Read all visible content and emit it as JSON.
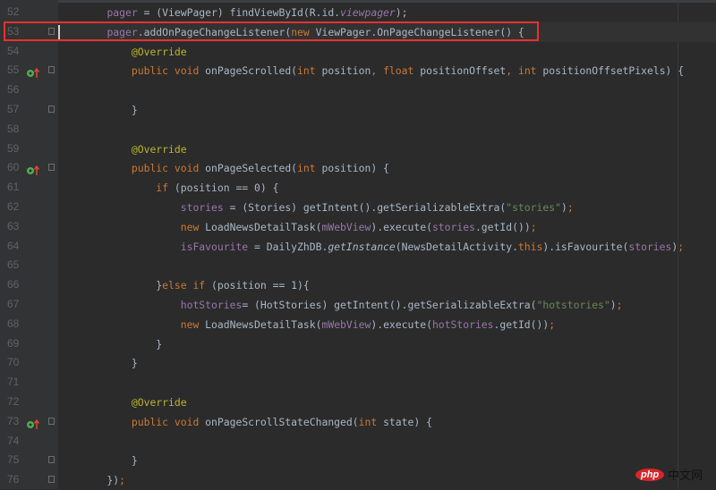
{
  "editor": {
    "current_line": 53,
    "highlighted_line": 53,
    "override_lines": [
      55,
      60,
      73
    ],
    "fold_lines": [
      53,
      55,
      57,
      60,
      73,
      75,
      76
    ],
    "lines": [
      {
        "num": "52",
        "tokens": [
          [
            "    ",
            ""
          ],
          [
            "pager",
            "f"
          ],
          [
            " = (ViewPager) findViewById(R.id.",
            ""
          ],
          [
            "viewpager",
            "fi"
          ],
          [
            ");",
            ""
          ]
        ]
      },
      {
        "num": "53",
        "tokens": [
          [
            "    ",
            ""
          ],
          [
            "pager",
            "f"
          ],
          [
            ".addOnPageChangeListener(",
            ""
          ],
          [
            "new ",
            "k"
          ],
          [
            "ViewPager.OnPageChangeListener() {",
            ""
          ]
        ]
      },
      {
        "num": "54",
        "tokens": [
          [
            "        ",
            ""
          ],
          [
            "@Override",
            "a"
          ]
        ]
      },
      {
        "num": "55",
        "tokens": [
          [
            "        ",
            ""
          ],
          [
            "public void ",
            "k"
          ],
          [
            "onPageScrolled(",
            ""
          ],
          [
            "int ",
            "k"
          ],
          [
            "position",
            ""
          ],
          [
            ", ",
            "k"
          ],
          [
            "float ",
            "k"
          ],
          [
            "positionOffset",
            ""
          ],
          [
            ", ",
            "k"
          ],
          [
            "int ",
            "k"
          ],
          [
            "positionOffsetPixels) {",
            ""
          ]
        ]
      },
      {
        "num": "56",
        "tokens": []
      },
      {
        "num": "57",
        "tokens": [
          [
            "        }",
            ""
          ]
        ]
      },
      {
        "num": "58",
        "tokens": []
      },
      {
        "num": "59",
        "tokens": [
          [
            "        ",
            ""
          ],
          [
            "@Override",
            "a"
          ]
        ]
      },
      {
        "num": "60",
        "tokens": [
          [
            "        ",
            ""
          ],
          [
            "public void ",
            "k"
          ],
          [
            "onPageSelected(",
            ""
          ],
          [
            "int ",
            "k"
          ],
          [
            "position) {",
            ""
          ]
        ]
      },
      {
        "num": "61",
        "tokens": [
          [
            "            ",
            ""
          ],
          [
            "if ",
            "k"
          ],
          [
            "(position == 0) {",
            ""
          ]
        ]
      },
      {
        "num": "62",
        "tokens": [
          [
            "                ",
            ""
          ],
          [
            "stories",
            "f"
          ],
          [
            " = (Stories) getIntent().getSerializableExtra(",
            ""
          ],
          [
            "\"stories\"",
            "s"
          ],
          [
            ")",
            ""
          ],
          [
            ";",
            "k"
          ]
        ]
      },
      {
        "num": "63",
        "tokens": [
          [
            "                ",
            ""
          ],
          [
            "new ",
            "k"
          ],
          [
            "LoadNewsDetailTask(",
            ""
          ],
          [
            "mWebView",
            "f"
          ],
          [
            ").execute(",
            ""
          ],
          [
            "stories",
            "f"
          ],
          [
            ".getId())",
            ""
          ],
          [
            ";",
            "k"
          ]
        ]
      },
      {
        "num": "64",
        "tokens": [
          [
            "                ",
            ""
          ],
          [
            "isFavourite",
            "f"
          ],
          [
            " = DailyZhDB.",
            ""
          ],
          [
            "getInstance",
            "i"
          ],
          [
            "(NewsDetailActivity.",
            ""
          ],
          [
            "this",
            "k"
          ],
          [
            ").isFavourite(",
            ""
          ],
          [
            "stories",
            "f"
          ],
          [
            ")",
            ""
          ],
          [
            ";",
            "k"
          ]
        ]
      },
      {
        "num": "65",
        "tokens": []
      },
      {
        "num": "66",
        "tokens": [
          [
            "            }",
            ""
          ],
          [
            "else if ",
            "k"
          ],
          [
            "(position == 1){",
            ""
          ]
        ]
      },
      {
        "num": "67",
        "tokens": [
          [
            "                ",
            ""
          ],
          [
            "hotStories",
            "f"
          ],
          [
            "= (HotStories) getIntent().getSerializableExtra(",
            ""
          ],
          [
            "\"hotstories\"",
            "s"
          ],
          [
            ")",
            ""
          ],
          [
            ";",
            "k"
          ]
        ]
      },
      {
        "num": "68",
        "tokens": [
          [
            "                ",
            ""
          ],
          [
            "new ",
            "k"
          ],
          [
            "LoadNewsDetailTask(",
            ""
          ],
          [
            "mWebView",
            "f"
          ],
          [
            ").execute(",
            ""
          ],
          [
            "hotStories",
            "f"
          ],
          [
            ".getId())",
            ""
          ],
          [
            ";",
            "k"
          ]
        ]
      },
      {
        "num": "69",
        "tokens": [
          [
            "            }",
            ""
          ]
        ]
      },
      {
        "num": "70",
        "tokens": [
          [
            "        }",
            ""
          ]
        ]
      },
      {
        "num": "71",
        "tokens": []
      },
      {
        "num": "72",
        "tokens": [
          [
            "        ",
            ""
          ],
          [
            "@Override",
            "a"
          ]
        ]
      },
      {
        "num": "73",
        "tokens": [
          [
            "        ",
            ""
          ],
          [
            "public void ",
            "k"
          ],
          [
            "onPageScrollStateChanged(",
            ""
          ],
          [
            "int ",
            "k"
          ],
          [
            "state) {",
            ""
          ]
        ]
      },
      {
        "num": "74",
        "tokens": []
      },
      {
        "num": "75",
        "tokens": [
          [
            "        }",
            ""
          ]
        ]
      },
      {
        "num": "76",
        "tokens": [
          [
            "    })",
            ""
          ],
          [
            ";",
            "k"
          ]
        ]
      }
    ]
  },
  "watermark": {
    "brand": "php",
    "text": "中文网"
  },
  "colors": {
    "background": "#2b2b2b",
    "keyword": "#cc7832",
    "field": "#9876aa",
    "string": "#6a8759",
    "annotation": "#bbb529",
    "highlight_box": "#e8312f"
  }
}
